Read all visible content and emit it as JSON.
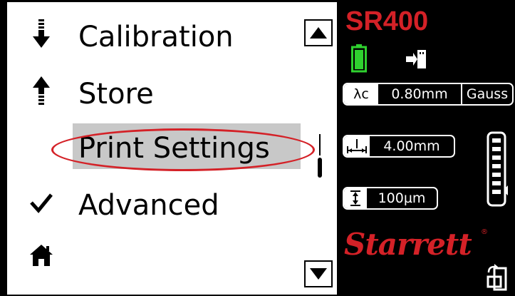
{
  "menu": {
    "items": [
      {
        "label": "Calibration",
        "icon": "download-arrow-icon"
      },
      {
        "label": "Store",
        "icon": "upload-arrow-icon"
      },
      {
        "label": "Print Settings",
        "icon": "none",
        "selected": true
      },
      {
        "label": "Advanced",
        "icon": "checkmark-icon"
      },
      {
        "label": "",
        "icon": "home-icon"
      }
    ],
    "scroll_up": "scroll-up-icon",
    "scroll_down": "scroll-down-icon"
  },
  "status": {
    "model": "SR400",
    "battery_color": "#2fd12f",
    "accent": "#d42127"
  },
  "settings": {
    "cutoff_symbol": "λc",
    "cutoff_value": "0.80mm",
    "filter": "Gauss",
    "eval_length": "4.00mm",
    "range": "100µm"
  },
  "brand": {
    "name": "Starrett",
    "mark": "®"
  }
}
